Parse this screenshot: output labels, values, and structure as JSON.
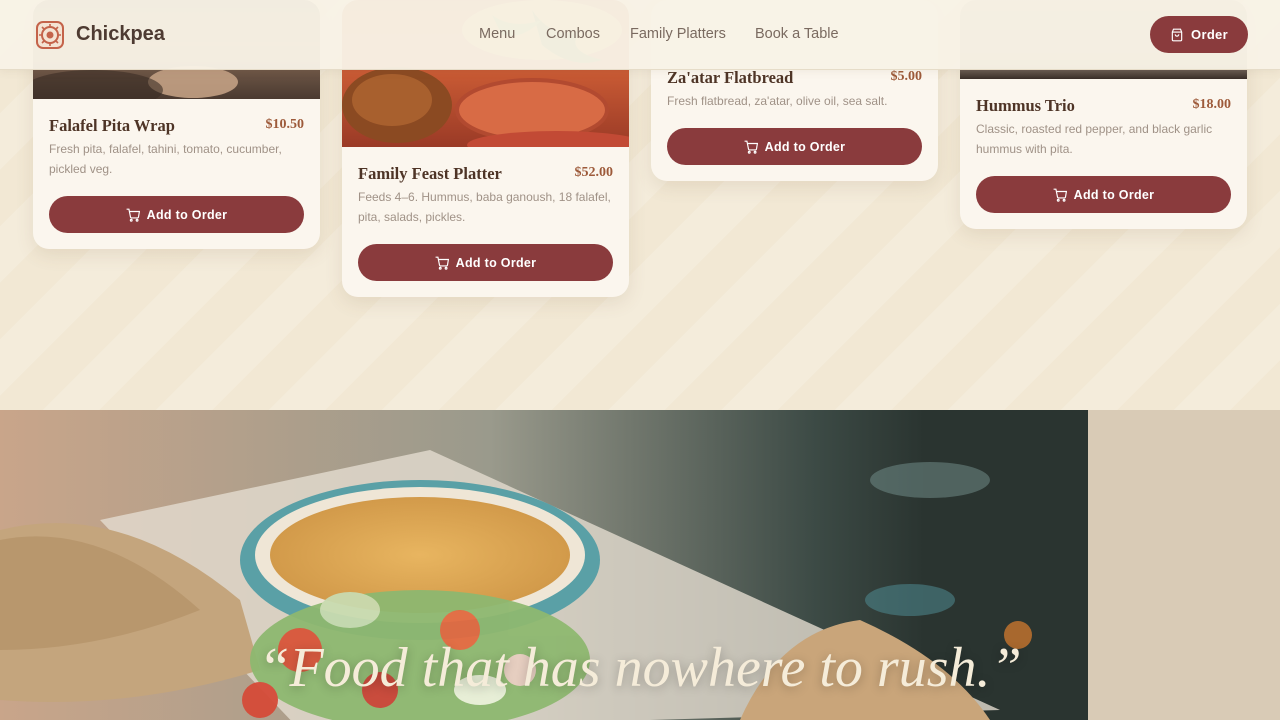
{
  "brand": {
    "name": "Chickpea"
  },
  "nav": {
    "items": [
      "Menu",
      "Combos",
      "Family Platters",
      "Book a Table"
    ],
    "order_label": "Order"
  },
  "cards": [
    {
      "title": "Falafel Pita Wrap",
      "price": "$10.50",
      "description": "Fresh pita, falafel, tahini, tomato, cucumber, pickled veg.",
      "button": "Add to Order"
    },
    {
      "title": "Family Feast Platter",
      "price": "$52.00",
      "description": "Feeds 4–6. Hummus, baba ganoush, 18 falafel, pita, salads, pickles.",
      "button": "Add to Order"
    },
    {
      "title": "Za'atar Flatbread",
      "price": "$5.00",
      "description": "Fresh flatbread, za'atar, olive oil, sea salt.",
      "button": "Add to Order"
    },
    {
      "title": "Hummus Trio",
      "price": "$18.00",
      "description": "Classic, roasted red pepper, and black garlic hummus with pita.",
      "button": "Add to Order"
    }
  ],
  "hero": {
    "quote": "“Food that has nowhere to rush.”"
  },
  "colors": {
    "accent": "#8a3b3d",
    "background": "#f3ead7",
    "price": "#9d5a3a"
  }
}
